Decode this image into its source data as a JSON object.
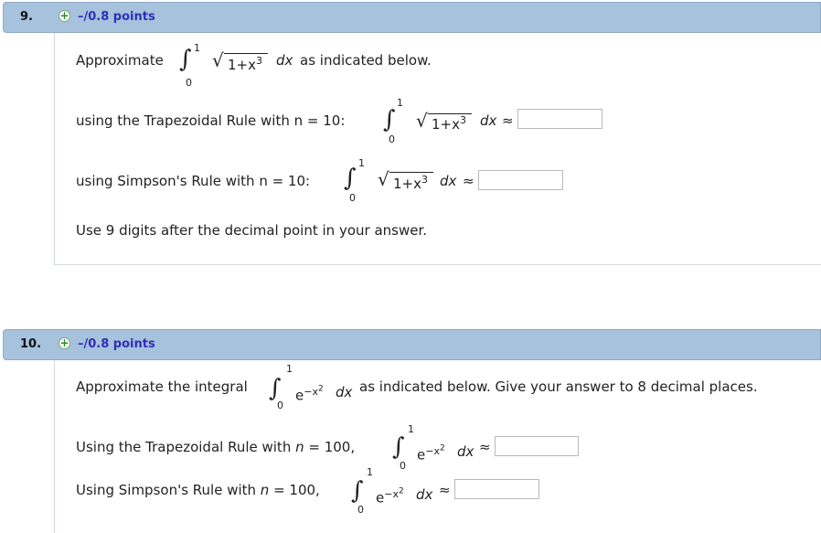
{
  "q9": {
    "number": "9.",
    "points": "–/0.8 points",
    "approx_label": "Approximate",
    "upper": "1",
    "lower": "0",
    "integrand": "1+x",
    "exp": "3",
    "dx": "dx",
    "as_indicated": "as indicated below.",
    "trap_label": "using the Trapezoidal Rule with n = 10:",
    "simp_label": "using Simpson's Rule with n = 10:",
    "approx_symbol": "≈",
    "note": "Use 9 digits after the decimal point in your answer."
  },
  "q10": {
    "number": "10.",
    "points": "–/0.8 points",
    "approx_label": "Approximate the integral",
    "upper": "1",
    "lower": "0",
    "integrand": "e",
    "exp": "−x",
    "exp2": "2",
    "dx": "dx",
    "as_indicated": "as indicated below. Give your answer to 8 decimal places.",
    "trap_prefix": "Using the Trapezoidal Rule with ",
    "simp_prefix": "Using Simpson's Rule with ",
    "n_var": "n",
    "n_value": " = 100,",
    "approx_symbol": "≈"
  }
}
